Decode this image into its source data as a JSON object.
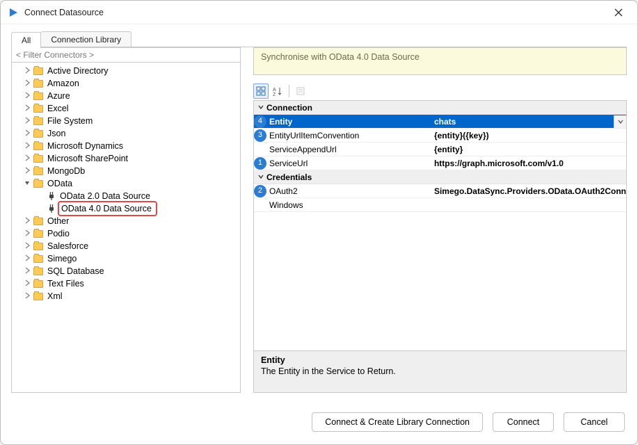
{
  "dialog": {
    "title": "Connect Datasource"
  },
  "tabs": {
    "all": "All",
    "library": "Connection Library"
  },
  "filter_placeholder": "< Filter Connectors >",
  "tree": {
    "items": [
      {
        "label": "Active Directory"
      },
      {
        "label": "Amazon"
      },
      {
        "label": "Azure"
      },
      {
        "label": "Excel"
      },
      {
        "label": "File System"
      },
      {
        "label": "Json"
      },
      {
        "label": "Microsoft Dynamics"
      },
      {
        "label": "Microsoft SharePoint"
      },
      {
        "label": "MongoDb"
      },
      {
        "label": "OData"
      },
      {
        "label": "Other"
      },
      {
        "label": "Podio"
      },
      {
        "label": "Salesforce"
      },
      {
        "label": "Simego"
      },
      {
        "label": "SQL Database"
      },
      {
        "label": "Text Files"
      },
      {
        "label": "Xml"
      }
    ],
    "odata_children": [
      {
        "label": "OData 2.0 Data Source"
      },
      {
        "label": "OData 4.0 Data Source"
      }
    ]
  },
  "info": "Synchronise with OData 4.0 Data Source",
  "grid": {
    "groups": [
      {
        "title": "Connection",
        "rows": [
          {
            "badge": "4",
            "name": "Entity",
            "value": "chats",
            "selected": true,
            "dropdown": true
          },
          {
            "badge": "3",
            "name": "EntityUrlItemConvention",
            "value": "{entity}({key})"
          },
          {
            "badge": "",
            "name": "ServiceAppendUrl",
            "value": "{entity}"
          },
          {
            "badge": "1",
            "name": "ServiceUrl",
            "value": "https://graph.microsoft.com/v1.0"
          }
        ]
      },
      {
        "title": "Credentials",
        "rows": [
          {
            "badge": "2",
            "name": "OAuth2",
            "value": "Simego.DataSync.Providers.OData.OAuth2Conn"
          },
          {
            "badge": "",
            "name": "Windows",
            "value": "",
            "normal": true
          }
        ]
      }
    ],
    "description": {
      "title": "Entity",
      "text": "The Entity in the Service to Return."
    }
  },
  "buttons": {
    "create": "Connect & Create Library Connection",
    "connect": "Connect",
    "cancel": "Cancel"
  }
}
